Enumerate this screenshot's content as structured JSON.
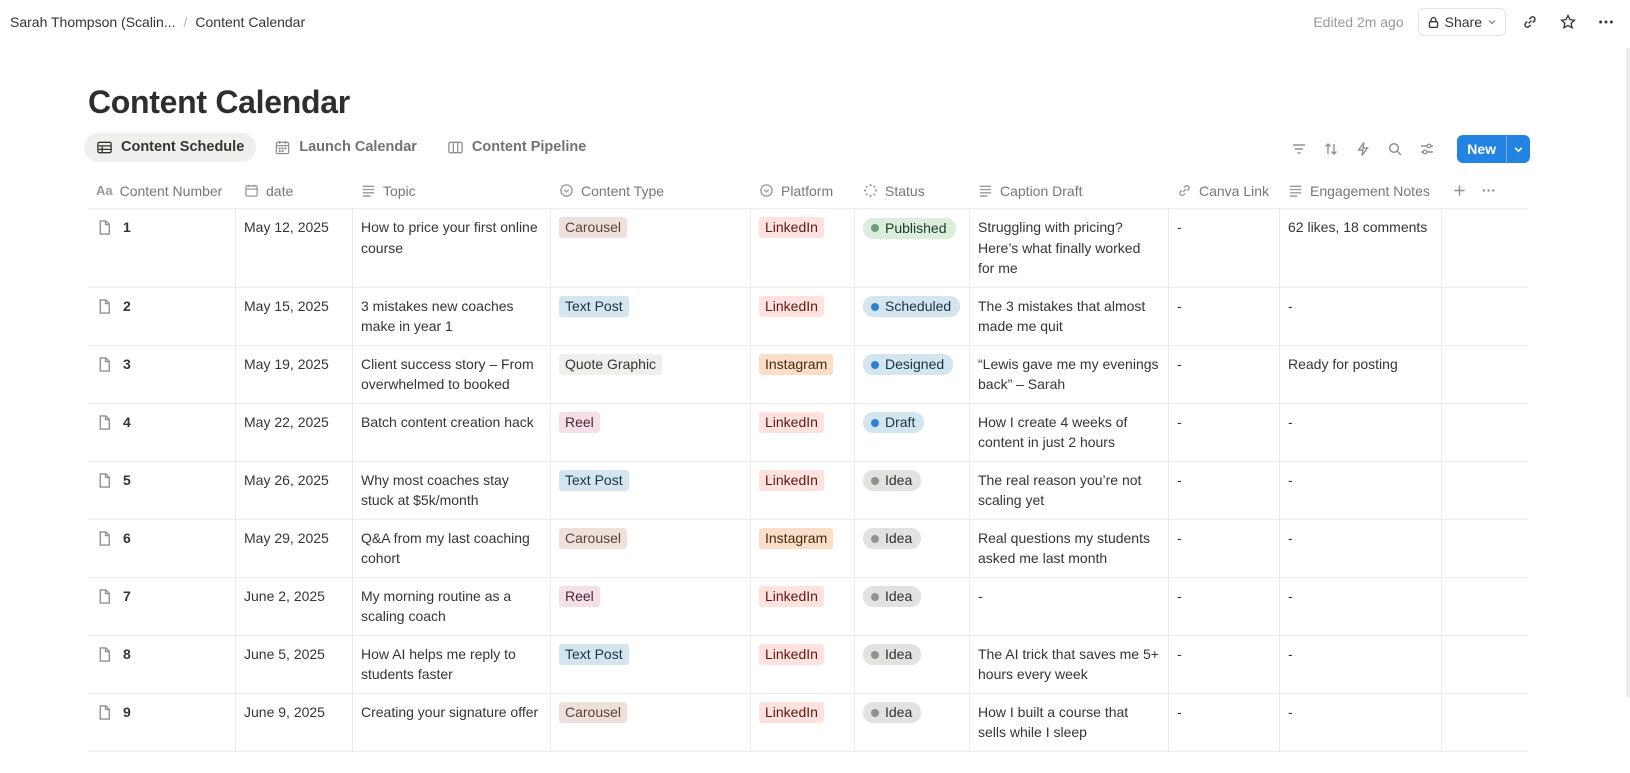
{
  "breadcrumb": {
    "workspace": "Sarah Thompson (Scalin...",
    "page": "Content Calendar"
  },
  "header": {
    "edited": "Edited 2m ago",
    "share_label": "Share"
  },
  "title": "Content Calendar",
  "views": [
    {
      "label": "Content Schedule",
      "icon": "table-icon"
    },
    {
      "label": "Launch Calendar",
      "icon": "calendar-icon"
    },
    {
      "label": "Content Pipeline",
      "icon": "board-icon"
    }
  ],
  "toolbar": {
    "new_label": "New"
  },
  "columns": [
    {
      "label": "Content Number",
      "icon": "title-aa-icon"
    },
    {
      "label": "date",
      "icon": "calendar-icon"
    },
    {
      "label": "Topic",
      "icon": "text-icon"
    },
    {
      "label": "Content Type",
      "icon": "select-icon"
    },
    {
      "label": "Platform",
      "icon": "select-icon"
    },
    {
      "label": "Status",
      "icon": "status-icon"
    },
    {
      "label": "Caption Draft",
      "icon": "text-icon"
    },
    {
      "label": "Canva Link",
      "icon": "link-icon"
    },
    {
      "label": "Engagement Notes",
      "icon": "text-icon"
    }
  ],
  "tag_colors": {
    "Carousel": {
      "bg": "#eee0da",
      "fg": "#5d4037"
    },
    "Text Post": {
      "bg": "#d3e5ef",
      "fg": "#183347"
    },
    "Quote Graphic": {
      "bg": "#efefed",
      "fg": "#37352f"
    },
    "Reel": {
      "bg": "#f5e0e9",
      "fg": "#4c2337"
    },
    "LinkedIn": {
      "bg": "#ffe2dd",
      "fg": "#5d1715"
    },
    "Instagram": {
      "bg": "#fadec9",
      "fg": "#49290e"
    }
  },
  "status_colors": {
    "Published": {
      "bg": "#dbeddb",
      "fg": "#1c3829",
      "dot": "#6c9b7d"
    },
    "Scheduled": {
      "bg": "#d3e5ef",
      "fg": "#183347",
      "dot": "#2f80d1"
    },
    "Designed": {
      "bg": "#d3e5ef",
      "fg": "#183347",
      "dot": "#2f80d1"
    },
    "Draft": {
      "bg": "#d3e5ef",
      "fg": "#183347",
      "dot": "#2f80d1"
    },
    "Idea": {
      "bg": "#e3e2e0",
      "fg": "#32302c",
      "dot": "#91918e"
    }
  },
  "rows": [
    {
      "num": "1",
      "date": "May 12, 2025",
      "topic": "How to price your first online course",
      "type": "Carousel",
      "platform": "LinkedIn",
      "status": "Published",
      "caption": "Struggling with pricing? Here’s what finally worked for me",
      "canva": "-",
      "notes": "62 likes, 18 comments"
    },
    {
      "num": "2",
      "date": "May 15, 2025",
      "topic": "3 mistakes new coaches make in year 1",
      "type": "Text Post",
      "platform": "LinkedIn",
      "status": "Scheduled",
      "caption": "The 3 mistakes that almost made me quit",
      "canva": "-",
      "notes": "-"
    },
    {
      "num": "3",
      "date": "May 19, 2025",
      "topic": "Client success story – From overwhelmed to booked",
      "type": "Quote Graphic",
      "platform": "Instagram",
      "status": "Designed",
      "caption": "“Lewis gave me my evenings back” – Sarah",
      "canva": "-",
      "notes": "Ready for posting"
    },
    {
      "num": "4",
      "date": "May 22, 2025",
      "topic": "Batch content creation hack",
      "type": "Reel",
      "platform": "LinkedIn",
      "status": "Draft",
      "caption": "How I create 4 weeks of content in just 2 hours",
      "canva": "-",
      "notes": "-"
    },
    {
      "num": "5",
      "date": "May 26, 2025",
      "topic": "Why most coaches stay stuck at $5k/month",
      "type": "Text Post",
      "platform": "LinkedIn",
      "status": "Idea",
      "caption": "The real reason you’re not scaling yet",
      "canva": "-",
      "notes": "-"
    },
    {
      "num": "6",
      "date": "May 29, 2025",
      "topic": "Q&A from my last coaching cohort",
      "type": "Carousel",
      "platform": "Instagram",
      "status": "Idea",
      "caption": "Real questions my students asked me last month",
      "canva": "-",
      "notes": "-"
    },
    {
      "num": "7",
      "date": "June 2, 2025",
      "topic": "My morning routine as a scaling coach",
      "type": "Reel",
      "platform": "LinkedIn",
      "status": "Idea",
      "caption": "-",
      "canva": "-",
      "notes": "-"
    },
    {
      "num": "8",
      "date": "June 5, 2025",
      "topic": "How AI helps me reply to students faster",
      "type": "Text Post",
      "platform": "LinkedIn",
      "status": "Idea",
      "caption": "The AI trick that saves me 5+ hours every week",
      "canva": "-",
      "notes": "-"
    },
    {
      "num": "9",
      "date": "June 9, 2025",
      "topic": "Creating your signature offer",
      "type": "Carousel",
      "platform": "LinkedIn",
      "status": "Idea",
      "caption": "How I built a course that sells while I sleep",
      "canva": "-",
      "notes": "-"
    }
  ]
}
